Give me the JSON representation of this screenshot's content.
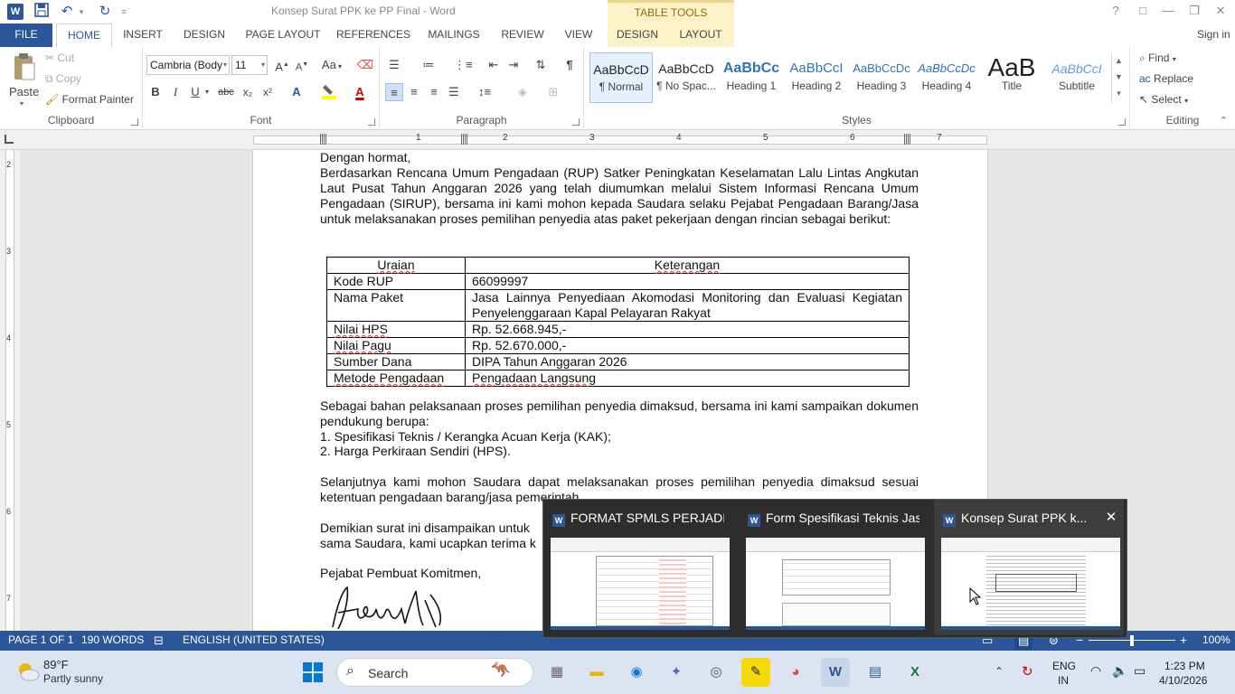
{
  "titlebar": {
    "doc_title": "Konsep Surat PPK ke PP Final - Word",
    "contextual": "TABLE TOOLS",
    "help": "?",
    "restore_ribbon": "□",
    "minimize": "—",
    "maximize": "❐",
    "close": "✕"
  },
  "tabs": {
    "file": "FILE",
    "home": "HOME",
    "insert": "INSERT",
    "design": "DESIGN",
    "page_layout": "PAGE LAYOUT",
    "references": "REFERENCES",
    "mailings": "MAILINGS",
    "review": "REVIEW",
    "view": "VIEW",
    "table_design": "DESIGN",
    "table_layout": "LAYOUT",
    "sign_in": "Sign in"
  },
  "clipboard": {
    "paste": "Paste",
    "cut": "Cut",
    "copy": "Copy",
    "format_painter": "Format Painter",
    "label": "Clipboard"
  },
  "font": {
    "family": "Cambria (Body",
    "size": "11",
    "label": "Font",
    "grow": "A",
    "shrink": "A",
    "case": "Aa",
    "bold": "B",
    "italic": "I",
    "underline": "U",
    "strike": "abc",
    "subscript": "x₂",
    "superscript": "x²"
  },
  "paragraph": {
    "label": "Paragraph",
    "pilcrow": "¶"
  },
  "styles": {
    "label": "Styles",
    "items": [
      {
        "sample": "AaBbCcD",
        "name": "¶ Normal"
      },
      {
        "sample": "AaBbCcD",
        "name": "¶ No Spac..."
      },
      {
        "sample": "AaBbCc",
        "name": "Heading 1"
      },
      {
        "sample": "AaBbCcI",
        "name": "Heading 2"
      },
      {
        "sample": "AaBbCcDc",
        "name": "Heading 3"
      },
      {
        "sample": "AaBbCcDc",
        "name": "Heading 4"
      },
      {
        "sample": "AaB",
        "name": "Title"
      },
      {
        "sample": "AaBbCcI",
        "name": "Subtitle"
      }
    ]
  },
  "editing": {
    "find": "Find",
    "replace": "Replace",
    "select": "Select",
    "label": "Editing"
  },
  "ruler": {
    "h_marks": [
      "1",
      "2",
      "3",
      "4",
      "5",
      "6",
      "7"
    ],
    "v_marks": [
      "2",
      "3",
      "4",
      "5",
      "6",
      "7"
    ]
  },
  "document": {
    "greeting": "Dengan hormat,",
    "para1": "Berdasarkan Rencana Umum Pengadaan (RUP) Satker Peningkatan Keselamatan Lalu Lintas Angkutan Laut Pusat Tahun Anggaran 2026 yang telah diumumkan melalui Sistem Informasi Rencana Umum Pengadaan (SIRUP), bersama ini kami mohon kepada Saudara selaku Pejabat Pengadaan Barang/Jasa untuk melaksanakan proses pemilihan penyedia atas paket pekerjaan dengan rincian sebagai berikut:",
    "table": {
      "headers": [
        "Uraian",
        "Keterangan"
      ],
      "rows": [
        [
          "Kode RUP",
          "66099997"
        ],
        [
          "Nama Paket",
          "Jasa Lainnya Penyediaan Akomodasi Monitoring dan Evaluasi Kegiatan Penyelenggaraan Kapal Pelayaran Rakyat"
        ],
        [
          "Nilai HPS",
          "Rp. 52.668.945,-"
        ],
        [
          "Nilai Pagu",
          "Rp. 52.670.000,-"
        ],
        [
          "Sumber Dana",
          "DIPA Tahun Anggaran 2026"
        ],
        [
          "Metode Pengadaan",
          "Pengadaan Langsung"
        ]
      ]
    },
    "para2": "Sebagai bahan pelaksanaan proses pemilihan penyedia dimaksud, bersama ini kami sampaikan dokumen pendukung berupa:",
    "list": [
      "1.  Spesifikasi Teknis / Kerangka Acuan Kerja (KAK);",
      "2.  Harga Perkiraan Sendiri (HPS)."
    ],
    "para3": "Selanjutnya kami mohon Saudara dapat melaksanakan proses pemilihan penyedia dimaksud sesuai ketentuan pengadaan barang/jasa pemerintah.",
    "para4_line1": "Demikian surat ini disampaikan untuk",
    "para4_line2": "sama Saudara, kami ucapkan terima k",
    "signer": "Pejabat Pembuat Komitmen,"
  },
  "statusbar": {
    "page": "PAGE 1 OF 1",
    "words": "190 WORDS",
    "language": "ENGLISH (UNITED STATES)",
    "zoom": "100%"
  },
  "taskbar_popup": {
    "windows": [
      {
        "title": "FORMAT SPMLS PERJADIN..."
      },
      {
        "title": "Form Spesifikasi Teknis Jas..."
      },
      {
        "title": "Konsep Surat PPK k..."
      }
    ],
    "close": "✕"
  },
  "taskbar": {
    "weather_temp": "89°F",
    "weather_desc": "Partly sunny",
    "search": "Search",
    "lang_line1": "ENG",
    "lang_line2": "IN",
    "time": "1:23 PM",
    "date": "4/10/2026"
  },
  "colors": {
    "word_blue": "#2b579a",
    "table_tools": "#fbf3c7",
    "taskbar": "#dbe4f0"
  }
}
